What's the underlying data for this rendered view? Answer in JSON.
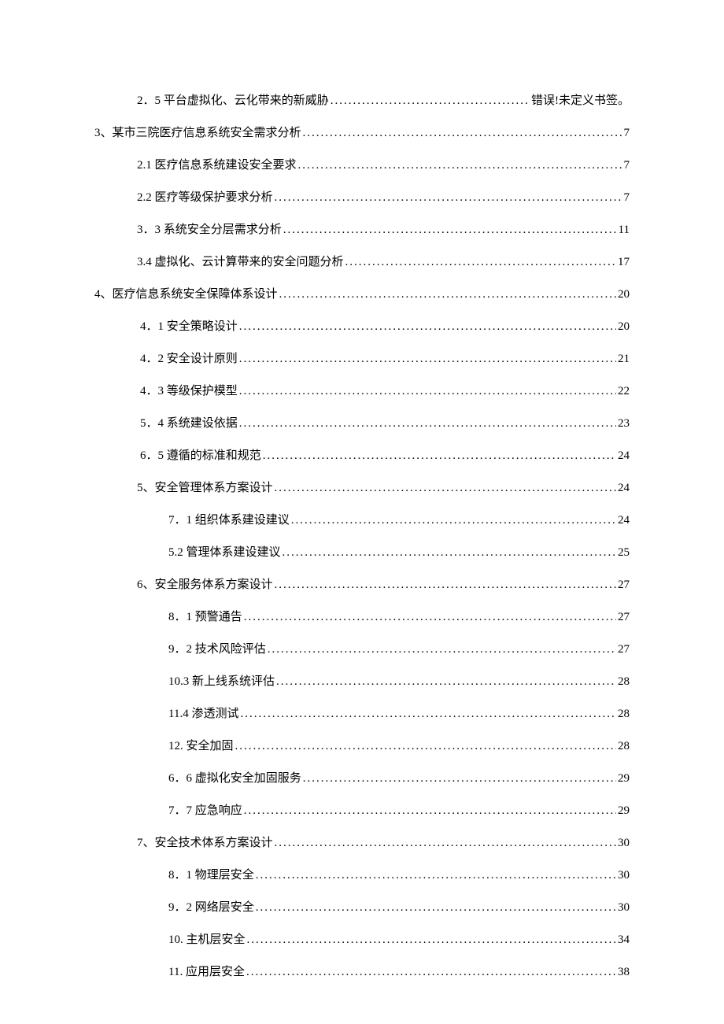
{
  "toc": [
    {
      "indent": 1,
      "label": "2．5 平台虚拟化、云化带来的新威胁",
      "page": "错误!未定义书签。"
    },
    {
      "indent": 0,
      "label": "3、某市三院医疗信息系统安全需求分析",
      "page": "7"
    },
    {
      "indent": 1,
      "label": "2.1  医疗信息系统建设安全要求",
      "page": "7"
    },
    {
      "indent": 1,
      "label": "2.2  医疗等级保护要求分析",
      "page": "7"
    },
    {
      "indent": 1,
      "label": "3．3 系统安全分层需求分析",
      "page": "11"
    },
    {
      "indent": 1,
      "label": "3.4 虚拟化、云计算带来的安全问题分析",
      "page": "17"
    },
    {
      "indent": 0,
      "label": "4、医疗信息系统安全保障体系设计",
      "page": "20"
    },
    {
      "indent": 2,
      "label": "4．1 安全策略设计",
      "page": "20"
    },
    {
      "indent": 2,
      "label": "4．2 安全设计原则",
      "page": "21"
    },
    {
      "indent": 2,
      "label": "4．3 等级保护模型",
      "page": "22"
    },
    {
      "indent": 2,
      "label": "5．4 系统建设依据",
      "page": "23"
    },
    {
      "indent": 2,
      "label": "6．5 遵循的标准和规范",
      "page": "24"
    },
    {
      "indent": 1,
      "label": "5、安全管理体系方案设计",
      "page": "24"
    },
    {
      "indent": 3,
      "label": "7．1 组织体系建设建议",
      "page": "24"
    },
    {
      "indent": 3,
      "label": "5.2 管理体系建设建议",
      "page": "25"
    },
    {
      "indent": 1,
      "label": "6、安全服务体系方案设计",
      "page": "27"
    },
    {
      "indent": 3,
      "label": "8．1 预警通告",
      "page": "27"
    },
    {
      "indent": 3,
      "label": "9．2 技术风险评估",
      "page": "27"
    },
    {
      "indent": 3,
      "label": "10.3 新上线系统评估",
      "page": "28"
    },
    {
      "indent": 3,
      "label": "11.4 渗透测试",
      "page": "28"
    },
    {
      "indent": 3,
      "label": "12.  安全加固",
      "page": "28"
    },
    {
      "indent": 3,
      "label": "6．6 虚拟化安全加固服务",
      "page": "29"
    },
    {
      "indent": 3,
      "label": "7．7 应急响应",
      "page": "29"
    },
    {
      "indent": 1,
      "label": "7、安全技术体系方案设计",
      "page": "30"
    },
    {
      "indent": 3,
      "label": "8．1 物理层安全",
      "page": "30"
    },
    {
      "indent": 3,
      "label": "9．2 网络层安全",
      "page": "30"
    },
    {
      "indent": 3,
      "label": "10.  主机层安全",
      "page": "34"
    },
    {
      "indent": 3,
      "label": "11.  应用层安全",
      "page": "38"
    }
  ]
}
